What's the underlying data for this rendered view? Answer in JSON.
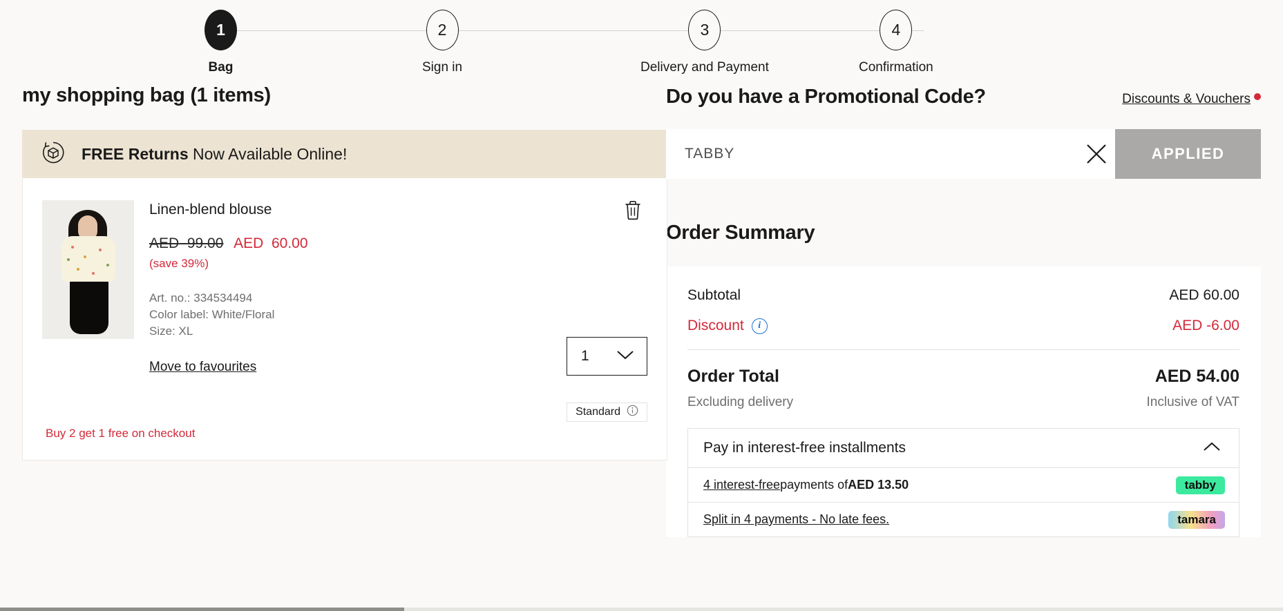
{
  "stepper": {
    "steps": [
      {
        "num": "1",
        "label": "Bag"
      },
      {
        "num": "2",
        "label": "Sign in"
      },
      {
        "num": "3",
        "label": "Delivery and Payment"
      },
      {
        "num": "4",
        "label": "Confirmation"
      }
    ]
  },
  "bag": {
    "title": "my shopping bag (1 items)",
    "returns_banner": {
      "icon": "returns-box-icon",
      "strong": "FREE Returns",
      "rest": " Now Available Online!"
    },
    "item": {
      "name": "Linen-blend blouse",
      "price_old_currency": "AED",
      "price_old": "99.00",
      "price_new_currency": "AED",
      "price_new": "60.00",
      "save": "(save 39%)",
      "art_no": "Art. no.: 334534494",
      "color_label": "Color label: White/Floral",
      "size": "Size: XL",
      "move_to_favourites": "Move to favourites",
      "quantity": "1",
      "shipping_badge": "Standard",
      "promo_note": "Buy 2 get 1 free on checkout",
      "delete_icon": "trash-icon"
    }
  },
  "promo": {
    "title": "Do you have a Promotional Code?",
    "link": "Discounts & Vouchers",
    "has_notification_dot": true,
    "input_value": "TABBY",
    "input_placeholder": "Promo code",
    "clear_icon": "close-icon",
    "apply_label": "APPLIED"
  },
  "order_summary": {
    "title": "Order Summary",
    "rows": [
      {
        "label": "Subtotal",
        "value": "AED 60.00",
        "accent": false
      },
      {
        "label": "Discount",
        "value": "AED -6.00",
        "accent": true
      }
    ],
    "total_label": "Order Total",
    "total_value": "AED 54.00",
    "total_note_left": "Excluding delivery",
    "total_note_right": "Inclusive of VAT"
  },
  "installments": {
    "header": "Pay in interest-free installments",
    "expanded": true,
    "chevron_icon": "chevron-up-icon",
    "options": [
      {
        "link_text": "4 interest-free",
        "mid_text": " payments of ",
        "amount": "AED 13.50",
        "provider": "tabby",
        "provider_style": "tabby"
      },
      {
        "link_text": "Split in 4 payments - No late fees.",
        "mid_text": "",
        "amount": "",
        "provider": "tamara",
        "provider_style": "tamara"
      }
    ]
  },
  "colors": {
    "accent_red": "#d3293a",
    "banner_bg": "#ece3d2",
    "page_bg": "#faf9f7",
    "applied_btn": "#aaa9a7",
    "info_blue": "#1a6fd4"
  }
}
